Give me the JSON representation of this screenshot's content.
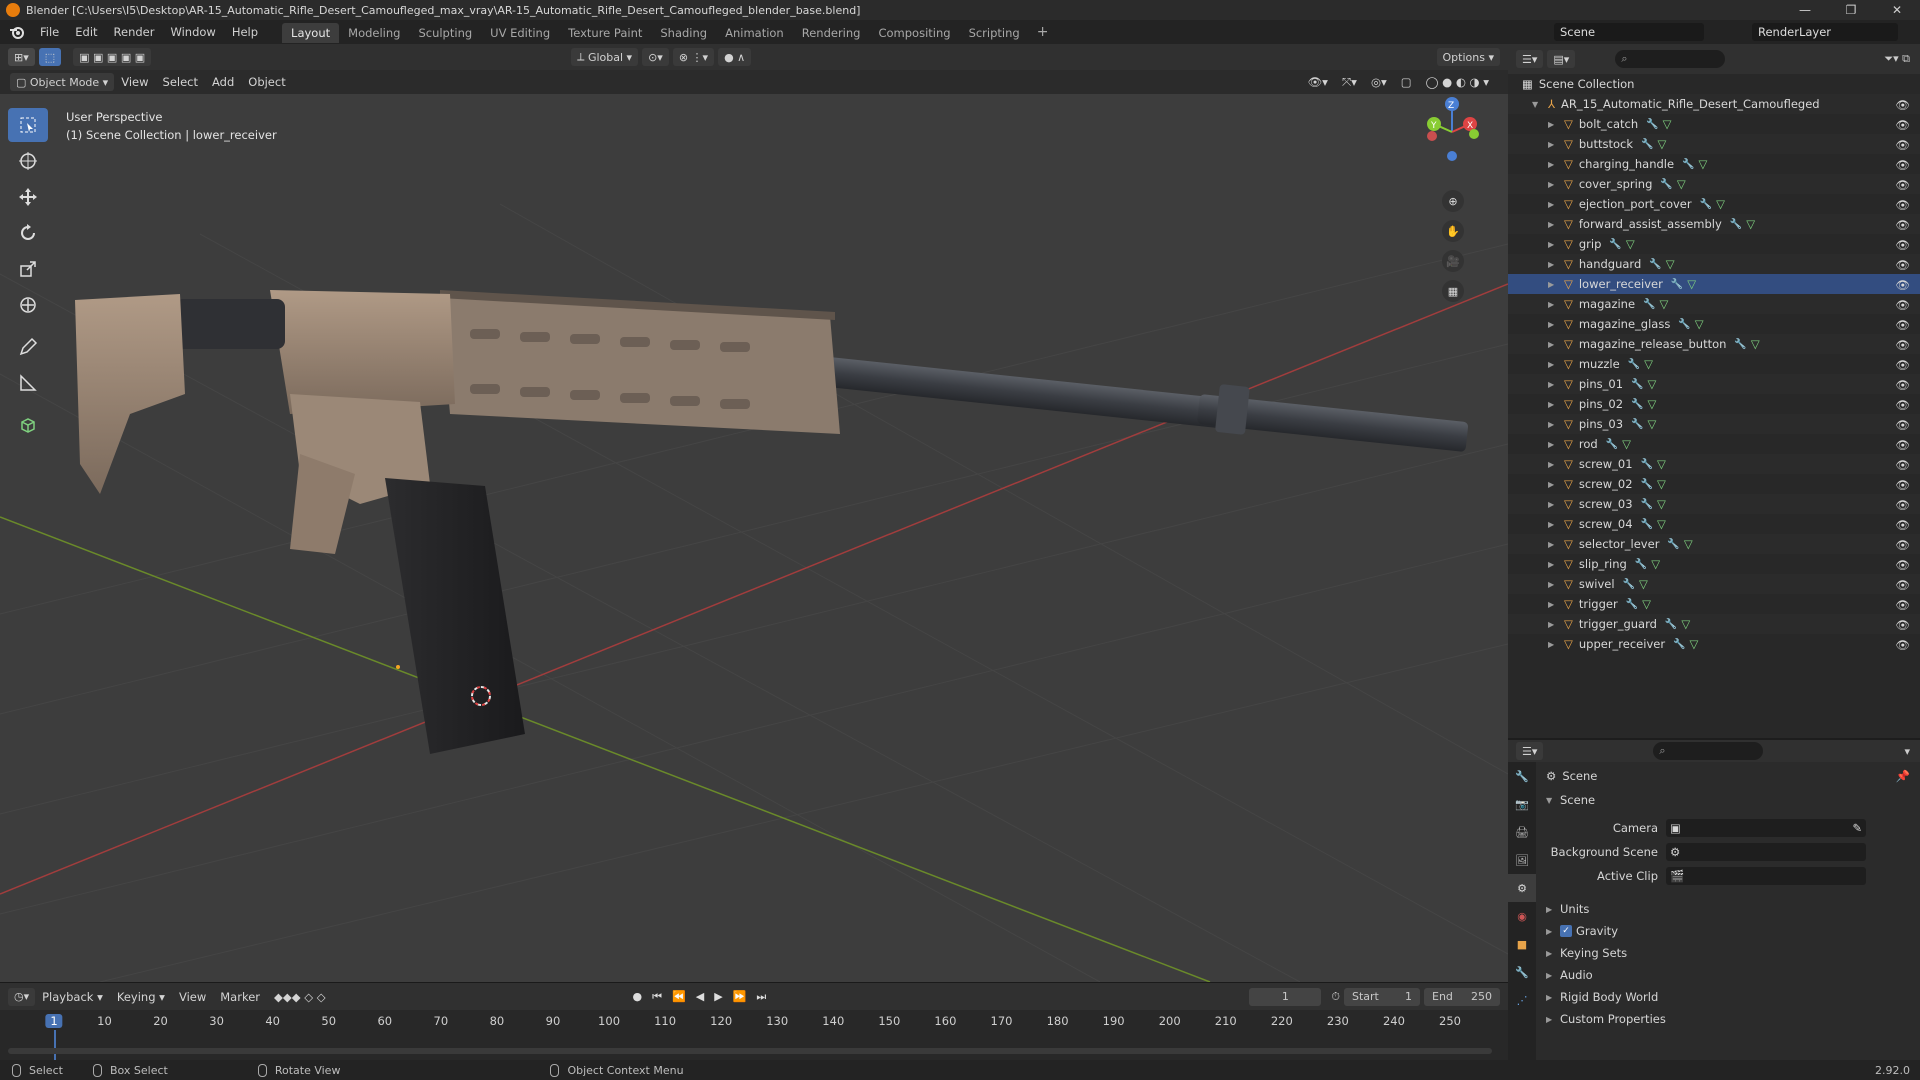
{
  "window": {
    "title": "Blender [C:\\Users\\I5\\Desktop\\AR-15_Automatic_Rifle_Desert_Camoufleged_max_vray\\AR-15_Automatic_Rifle_Desert_Camoufleged_blender_base.blend]",
    "controls": [
      "—",
      "❐",
      "✕"
    ]
  },
  "menu": [
    "File",
    "Edit",
    "Render",
    "Window",
    "Help"
  ],
  "workspaces": [
    {
      "label": "Layout",
      "active": true
    },
    {
      "label": "Modeling"
    },
    {
      "label": "Sculpting"
    },
    {
      "label": "UV Editing"
    },
    {
      "label": "Texture Paint"
    },
    {
      "label": "Shading"
    },
    {
      "label": "Animation"
    },
    {
      "label": "Rendering"
    },
    {
      "label": "Compositing"
    },
    {
      "label": "Scripting"
    }
  ],
  "scene_selector": "Scene",
  "view_layer": "RenderLayer",
  "viewport": {
    "transform_orientation": "Global",
    "options_label": "Options",
    "mode": "Object Mode",
    "menus": [
      "View",
      "Select",
      "Add",
      "Object"
    ],
    "perspective_label": "User Perspective",
    "context_label": "(1) Scene Collection | lower_receiver"
  },
  "outliner": {
    "root": "Scene Collection",
    "collection": "AR_15_Automatic_Rifle_Desert_Camoufleged",
    "objects": [
      "bolt_catch",
      "buttstock",
      "charging_handle",
      "cover_spring",
      "ejection_port_cover",
      "forward_assist_assembly",
      "grip",
      "handguard",
      "lower_receiver",
      "magazine",
      "magazine_glass",
      "magazine_release_button",
      "muzzle",
      "pins_01",
      "pins_02",
      "pins_03",
      "rod",
      "screw_01",
      "screw_02",
      "screw_03",
      "screw_04",
      "selector_lever",
      "slip_ring",
      "swivel",
      "trigger",
      "trigger_guard",
      "upper_receiver"
    ],
    "selected": "lower_receiver"
  },
  "properties": {
    "context": "Scene",
    "panel": "Scene",
    "fields": [
      {
        "label": "Camera"
      },
      {
        "label": "Background Scene"
      },
      {
        "label": "Active Clip"
      }
    ],
    "subpanels": [
      "Units",
      "Gravity",
      "Keying Sets",
      "Audio",
      "Rigid Body World",
      "Custom Properties"
    ],
    "gravity_checked": true
  },
  "timeline": {
    "menus": [
      "Playback",
      "Keying",
      "View",
      "Marker"
    ],
    "current_frame": "1",
    "start_label": "Start",
    "start": "1",
    "end_label": "End",
    "end": "250",
    "ticks": [
      "1",
      "10",
      "20",
      "30",
      "40",
      "50",
      "60",
      "70",
      "80",
      "90",
      "100",
      "110",
      "120",
      "130",
      "140",
      "150",
      "160",
      "170",
      "180",
      "190",
      "200",
      "210",
      "220",
      "230",
      "240",
      "250"
    ]
  },
  "statusbar": {
    "select": "Select",
    "box_select": "Box Select",
    "rotate": "Rotate View",
    "context_menu": "Object Context Menu",
    "version": "2.92.0"
  }
}
